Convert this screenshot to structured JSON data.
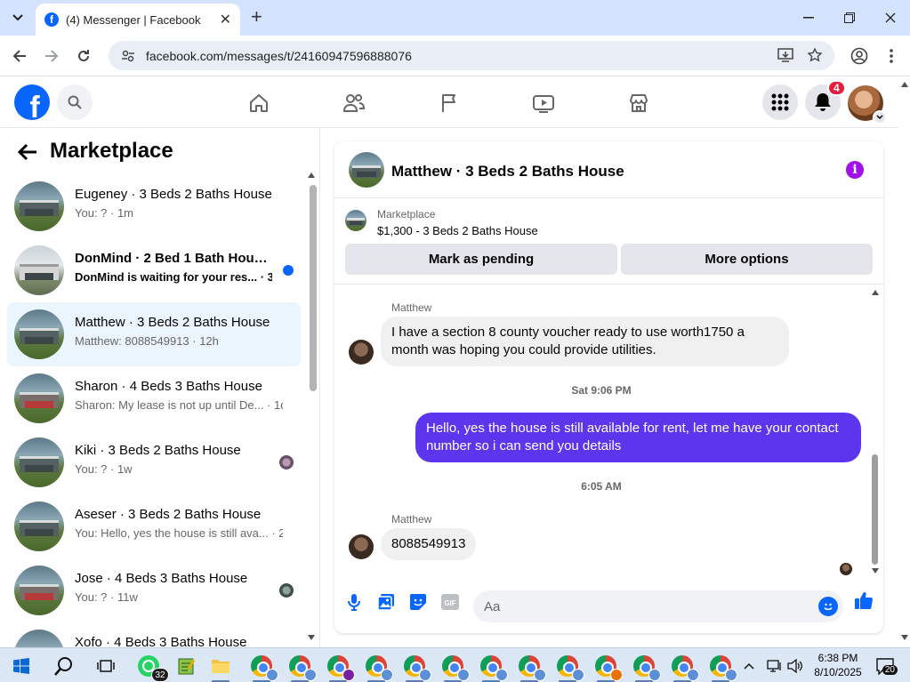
{
  "browser": {
    "tab_title": "(4) Messenger | Facebook",
    "url": "facebook.com/messages/t/24160947596888076"
  },
  "header": {
    "notification_count": "4"
  },
  "left": {
    "title": "Marketplace",
    "conversations": [
      {
        "name": "Eugeney · 3 Beds 2 Baths House",
        "preview": "You: ? · 1m",
        "unread": false,
        "active": false
      },
      {
        "name": "DonMind · 2 Bed 1 Bath House...",
        "preview": "DonMind is waiting for your res... · 3h",
        "unread": true,
        "active": false
      },
      {
        "name": "Matthew · 3 Beds 2 Baths House",
        "preview": "Matthew: 8088549913 · 12h",
        "unread": false,
        "active": true
      },
      {
        "name": "Sharon · 4 Beds 3 Baths House",
        "preview": "Sharon: My lease is not up until De... · 1d",
        "unread": false,
        "active": false
      },
      {
        "name": "Kiki · 3 Beds 2 Baths House",
        "preview": "You: ? · 1w",
        "unread": false,
        "active": false
      },
      {
        "name": "Aseser · 3 Beds 2 Baths House",
        "preview": "You: Hello, yes the house is still ava... · 2w",
        "unread": false,
        "active": false
      },
      {
        "name": "Jose · 4 Beds 3 Baths House",
        "preview": "You: ? · 11w",
        "unread": false,
        "active": false
      },
      {
        "name": "Xofo · 4 Beds 3 Baths House",
        "preview": "",
        "unread": false,
        "active": false
      }
    ]
  },
  "chat": {
    "title": "Matthew · 3 Beds 2 Baths House",
    "marketplace_label": "Marketplace",
    "listing": "$1,300 - 3 Beds 2 Baths House",
    "mark_pending": "Mark as pending",
    "more_options": "More options",
    "sender_1": "Matthew",
    "msg_1": "I have a section 8 county voucher ready to use worth1750 a month was hoping you could provide utilities.",
    "ts_1": "Sat 9:06 PM",
    "msg_2": "Hello, yes the house is still available for rent, let me have your contact number so i can send you  details",
    "ts_2": "6:05 AM",
    "sender_3": "Matthew",
    "msg_3": "8088549913",
    "input_placeholder": "Aa"
  },
  "taskbar": {
    "whatsapp_badge": "32",
    "time": "6:38 PM",
    "date": "8/10/2025",
    "notifications": "20"
  }
}
